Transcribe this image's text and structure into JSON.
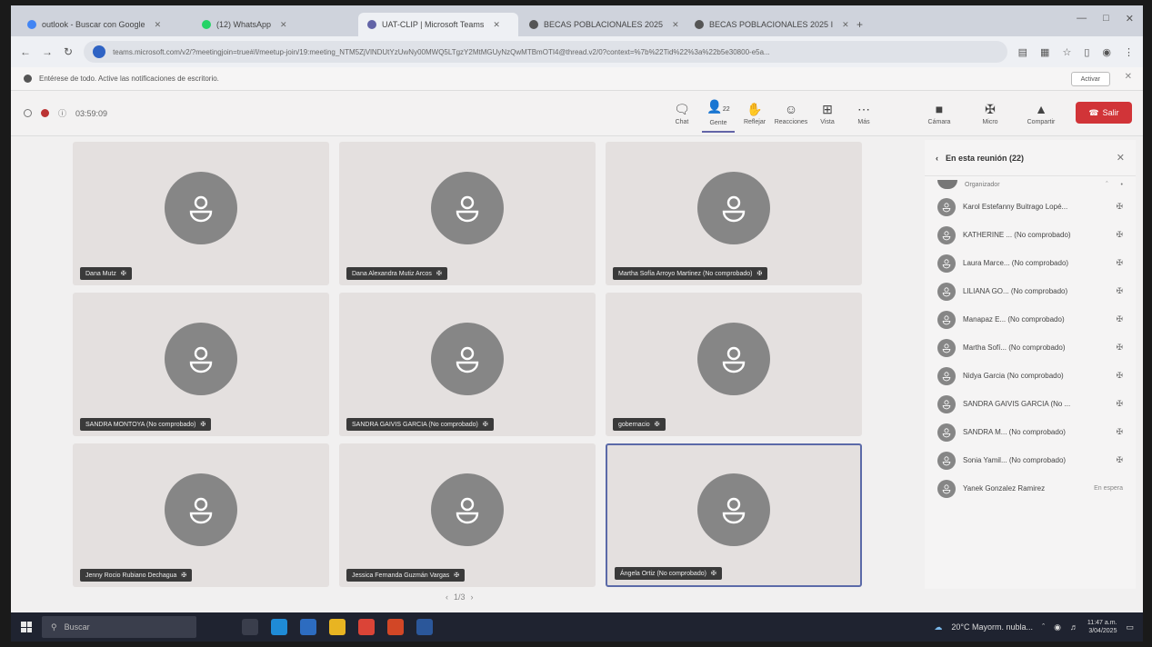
{
  "browser": {
    "tabs": [
      {
        "title": "outlook - Buscar con Google",
        "favicon_color": "#4285f4",
        "active": false
      },
      {
        "title": "(12) WhatsApp",
        "favicon_color": "#25d366",
        "active": false
      },
      {
        "title": "UAT-CLIP | Microsoft Teams",
        "favicon_color": "#6264a7",
        "active": true
      },
      {
        "title": "BECAS POBLACIONALES 2025",
        "favicon_color": "#555555",
        "active": false
      },
      {
        "title": "BECAS POBLACIONALES 2025 I",
        "favicon_color": "#555555",
        "active": false
      }
    ],
    "url": "teams.microsoft.com/v2/?meetingjoin=true#/l/meetup-join/19:meeting_NTM5ZjVlNDUtYzUwNy00MWQ5LTgzY2MtMGUyNzQwMTBmOTI4@thread.v2/0?context=%7b%22Tid%22%3a%22b5e30800-e5a..."
  },
  "notification": {
    "text": "Entérese de todo. Active las notificaciones de escritorio.",
    "button_label": "Activar"
  },
  "meeting": {
    "elapsed": "03:59:09",
    "toolbar": [
      {
        "label": "Chat",
        "glyph": "🗨",
        "icon": "chat-icon"
      },
      {
        "label": "Gente",
        "glyph": "👤",
        "badge": "22",
        "icon": "people-icon",
        "selected": true
      },
      {
        "label": "Reflejar",
        "glyph": "✋",
        "icon": "raise-hand-icon"
      },
      {
        "label": "Reacciones",
        "glyph": "☺",
        "icon": "reactions-icon"
      },
      {
        "label": "Vista",
        "glyph": "⊞",
        "icon": "view-icon"
      },
      {
        "label": "Más",
        "glyph": "⋯",
        "icon": "more-icon"
      }
    ],
    "media": [
      {
        "label": "Cámara",
        "glyph": "■",
        "icon": "camera-off-icon"
      },
      {
        "label": "Micro",
        "glyph": "✠",
        "icon": "mic-off-icon"
      },
      {
        "label": "Compartir",
        "glyph": "▲",
        "icon": "share-icon"
      }
    ],
    "leave_label": "Salir"
  },
  "tiles": [
    {
      "name": "Dana Mutz"
    },
    {
      "name": "Dana Alexandra Mutiz Arcos"
    },
    {
      "name": "Martha Sofía Arroyo Martinez (No comprobado)"
    },
    {
      "name": "SANDRA MONTOYA (No comprobado)"
    },
    {
      "name": "SANDRA GAIVIS GARCIA (No comprobado)"
    },
    {
      "name": "gobernacio"
    },
    {
      "name": "Jenny Rocio Rubiano Dechagua"
    },
    {
      "name": "Jessica Fernanda Guzmán Vargas"
    },
    {
      "name": "Ángela Ortiz (No comprobado)",
      "active": true
    }
  ],
  "pager": "1/3",
  "panel": {
    "title": "En esta reunión (22)",
    "organizer_label": "Organizador",
    "participants": [
      {
        "name": "Karol Estefanny Buitrago Lopé...",
        "status": ""
      },
      {
        "name": "KATHERINE ... (No comprobado)",
        "status": ""
      },
      {
        "name": "Laura Marce... (No comprobado)",
        "status": ""
      },
      {
        "name": "LILIANA GO... (No comprobado)",
        "status": ""
      },
      {
        "name": "Manapaz E... (No comprobado)",
        "status": ""
      },
      {
        "name": "Martha Sofí... (No comprobado)",
        "status": ""
      },
      {
        "name": "Nidya Garcia (No comprobado)",
        "status": ""
      },
      {
        "name": "SANDRA GAIVIS GARCIA (No ...",
        "status": ""
      },
      {
        "name": "SANDRA M... (No comprobado)",
        "status": ""
      },
      {
        "name": "Sonia Yamil... (No comprobado)",
        "status": ""
      },
      {
        "name": "Yanek Gonzalez Ramirez",
        "status": "En espera"
      }
    ]
  },
  "taskbar": {
    "search_placeholder": "Buscar",
    "apps": [
      {
        "icon": "task-view-icon",
        "color": "#3a3e4c"
      },
      {
        "icon": "edge-icon",
        "color": "#1f8bd6"
      },
      {
        "icon": "store-icon",
        "color": "#2d6cc0"
      },
      {
        "icon": "file-explorer-icon",
        "color": "#e8b422"
      },
      {
        "icon": "chrome-icon",
        "color": "#db4437"
      },
      {
        "icon": "powerpoint-icon",
        "color": "#d24726"
      },
      {
        "icon": "word-icon",
        "color": "#2b579a"
      }
    ],
    "weather": "20°C Mayorm. nubla...",
    "time": "11:47 a.m.",
    "date": "3/04/2025"
  }
}
